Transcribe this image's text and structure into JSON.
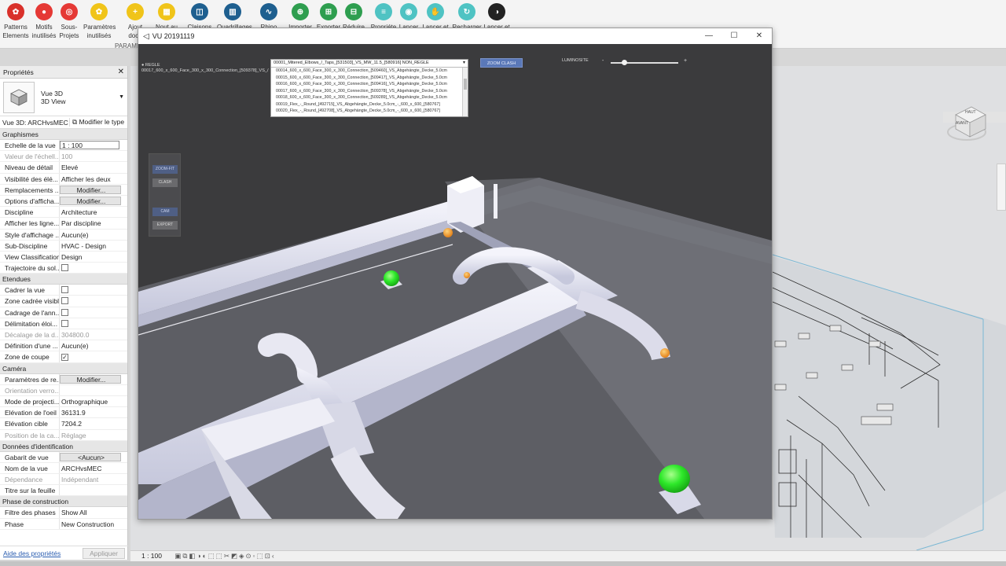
{
  "ribbon": {
    "buttons": [
      {
        "label": "Patterns\nElements",
        "color": "#d9312b",
        "glyph": "✿"
      },
      {
        "label": "Motifs\ninutilisés",
        "color": "#e53935",
        "glyph": "●"
      },
      {
        "label": "Sous-\nProjets",
        "color": "#e53935",
        "glyph": "◎"
      },
      {
        "label": "Paramètres\ninutilisés",
        "color": "#f0c419",
        "glyph": "✿"
      },
      {
        "label": "Ajout\ndocu",
        "color": "#f0c419",
        "glyph": "+"
      },
      {
        "label": "Nout au",
        "color": "#f0c419",
        "glyph": "▦"
      },
      {
        "label": "Claisons",
        "color": "#1e5f8f",
        "glyph": "◫"
      },
      {
        "label": "Quadrillages",
        "color": "#1e5f8f",
        "glyph": "▥"
      },
      {
        "label": "Rhino",
        "color": "#1e5f8f",
        "glyph": "∿"
      },
      {
        "label": "Importer",
        "color": "#2e9e4f",
        "glyph": "⊕"
      },
      {
        "label": "Exporter",
        "color": "#2e9e4f",
        "glyph": "⊞"
      },
      {
        "label": "Réduire",
        "color": "#2e9e4f",
        "glyph": "⊟"
      },
      {
        "label": "Propriéte",
        "color": "#4fc3c3",
        "glyph": "≡"
      },
      {
        "label": "Lancer",
        "color": "#4fc3c3",
        "glyph": "◉"
      },
      {
        "label": "Lancer et",
        "color": "#4fc3c3",
        "glyph": "✋"
      },
      {
        "label": "Recharger",
        "color": "#4fc3c3",
        "glyph": "↻"
      },
      {
        "label": "Lancer et",
        "color": "#222222",
        "glyph": "◑"
      }
    ],
    "group_label": "PARAME"
  },
  "properties": {
    "title": "Propriétés",
    "close": "✕",
    "view_type_line1": "Vue 3D",
    "view_type_line2": "3D View",
    "selector": "Vue 3D: ARCHvsMEC",
    "edit_type": "Modifier le type",
    "sections": [
      {
        "name": "Graphismes",
        "rows": [
          {
            "k": "Echelle de la vue",
            "v": "1 : 100",
            "style": "boxed"
          },
          {
            "k": "Valeur de l'échell...",
            "v": "100",
            "style": "dim"
          },
          {
            "k": "Niveau de détail",
            "v": "Elevé"
          },
          {
            "k": "Visibilité des élé...",
            "v": "Afficher les deux"
          },
          {
            "k": "Remplacements ...",
            "v": "Modifier...",
            "style": "button"
          },
          {
            "k": "Options d'afficha...",
            "v": "Modifier...",
            "style": "button"
          },
          {
            "k": "Discipline",
            "v": "Architecture"
          },
          {
            "k": "Afficher les ligne...",
            "v": "Par discipline"
          },
          {
            "k": "Style d'affichage ...",
            "v": "Aucun(e)"
          },
          {
            "k": "Sub-Discipline",
            "v": "HVAC - Design"
          },
          {
            "k": "View Classification",
            "v": "Design"
          },
          {
            "k": "Trajectoire du sol...",
            "v": "",
            "style": "check"
          }
        ]
      },
      {
        "name": "Etendues",
        "rows": [
          {
            "k": "Cadrer la vue",
            "v": "",
            "style": "check"
          },
          {
            "k": "Zone cadrée visible",
            "v": "",
            "style": "check"
          },
          {
            "k": "Cadrage de l'ann...",
            "v": "",
            "style": "check"
          },
          {
            "k": "Délimitation éloi...",
            "v": "",
            "style": "check"
          },
          {
            "k": "Décalage de la d...",
            "v": "304800.0",
            "style": "dim"
          },
          {
            "k": "Définition d'une ...",
            "v": "Aucun(e)"
          },
          {
            "k": "Zone de coupe",
            "v": "✓",
            "style": "check"
          }
        ]
      },
      {
        "name": "Caméra",
        "rows": [
          {
            "k": "Paramètres de re...",
            "v": "Modifier...",
            "style": "button"
          },
          {
            "k": "Orientation verro...",
            "v": "",
            "style": "dim"
          },
          {
            "k": "Mode de projecti...",
            "v": "Orthographique"
          },
          {
            "k": "Elévation de l'oeil",
            "v": "36131.9"
          },
          {
            "k": "Elévation cible",
            "v": "7204.2"
          },
          {
            "k": "Position de la ca...",
            "v": "Réglage",
            "style": "dim"
          }
        ]
      },
      {
        "name": "Données d'identification",
        "rows": [
          {
            "k": "Gabarit de vue",
            "v": "<Aucun>",
            "style": "button"
          },
          {
            "k": "Nom de la vue",
            "v": "ARCHvsMEC"
          },
          {
            "k": "Dépendance",
            "v": "Indépendant",
            "style": "dim"
          },
          {
            "k": "Titre sur la feuille",
            "v": ""
          }
        ]
      },
      {
        "name": "Phase de construction",
        "rows": [
          {
            "k": "Filtre des phases",
            "v": "Show All"
          },
          {
            "k": "Phase",
            "v": "New Construction"
          }
        ]
      }
    ],
    "help_link": "Aide des propriétés",
    "apply": "Appliquer"
  },
  "status": {
    "scale": "1 : 100"
  },
  "unity": {
    "title": "VU 20191119",
    "minimize": "—",
    "maximize": "☐",
    "close": "✕",
    "regle_label": "● REGLE",
    "regle_line": "00017_600_x_600_Face_300_x_300_Connection_[509378]_VS_/",
    "dropdown": {
      "selected": "00001_Mitered_Elbows_/_Taps_[531503]_VS_MW_11.5_[580916] NON_REGLE",
      "items": [
        "00014_600_x_600_Face_300_x_300_Connection_[509460]_VS_Abgehängte_Decke_5.0cm",
        "00015_600_x_600_Face_300_x_300_Connection_[509417]_VS_Abgehängte_Decke_5.0cm",
        "00016_600_x_600_Face_300_x_300_Connection_[509416]_VS_Abgehängte_Decke_5.0cm",
        "00017_600_x_600_Face_300_x_300_Connection_[509378]_VS_Abgehängte_Decke_5.0cm",
        "00018_600_x_600_Face_300_x_300_Connection_[509289]_VS_Abgehängte_Decke_5.0cm",
        "00019_Flex_-_Round_[492715]_VS_Abgehängte_Decke_5.0cm_-_600_x_600_[580767]",
        "00020_Flex_-_Round_[492708]_VS_Abgehängte_Decke_5.0cm_-_600_x_600_[580767]"
      ]
    },
    "zoom_clash": "ZOOM CLASH",
    "luminosite": "LUMINOSITE",
    "lum_minus": "-",
    "lum_plus": "+",
    "luminosity_level": 0.2,
    "tools": [
      "ZOOM-FIT",
      "CLASH",
      "CAM",
      "EXPORT"
    ]
  },
  "viewcube": {
    "top": "HAUT",
    "front": "AVANT"
  }
}
